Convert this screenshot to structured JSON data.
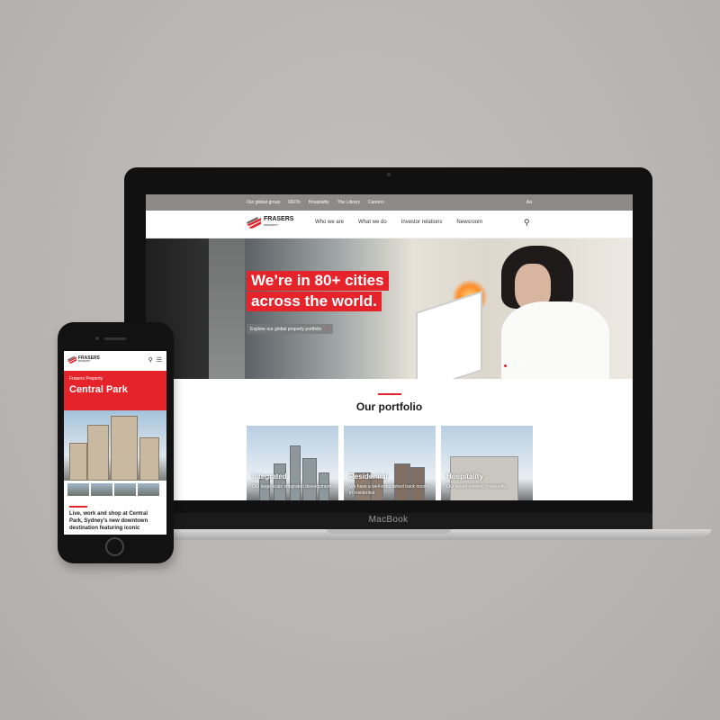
{
  "desktop": {
    "utility_nav": [
      "Our global group",
      "REITs",
      "Hospitality",
      "The Library",
      "Careers"
    ],
    "utility_right": "Aa",
    "logo_name": "FRASERS",
    "logo_sub": "PROPERTY",
    "main_nav": [
      "Who we are",
      "What we do",
      "Investor relations",
      "Newsroom"
    ],
    "hero": {
      "line1": "We’re in 80+ cities",
      "line2": "across the world.",
      "cta": "Explore our global property portfolio"
    },
    "portfolio": {
      "title": "Our portfolio",
      "cards": [
        {
          "label": "Integrated",
          "desc": "Our large-scale integrated development..."
        },
        {
          "label": "Residential",
          "desc": "We have a well-established track record in residential"
        },
        {
          "label": "Hospitality",
          "desc": "Our award-winning hospitality..."
        }
      ]
    }
  },
  "laptop_brand": "MacBook",
  "mobile": {
    "logo_name": "FRASERS",
    "logo_sub": "PROPERTY",
    "subtitle": "Frasers Property",
    "title": "Central Park",
    "body": "Live, work and shop at Central Park, Sydney's new downtown destination featuring iconic"
  },
  "colors": {
    "accent": "#e4232a",
    "background": "#bcb8b6"
  }
}
